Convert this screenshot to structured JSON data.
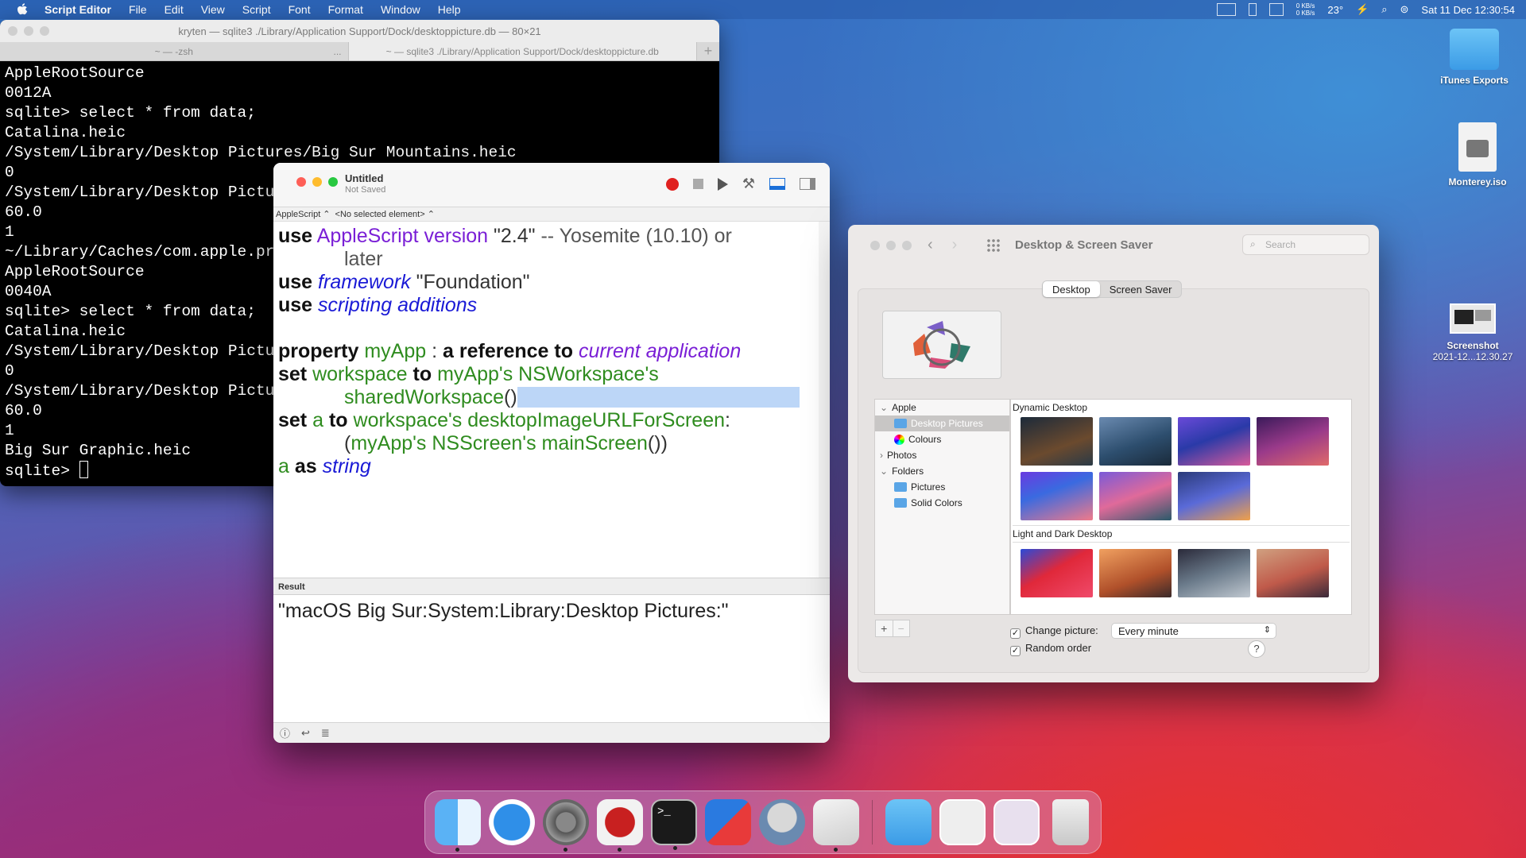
{
  "menubar": {
    "app": "Script Editor",
    "items": [
      "File",
      "Edit",
      "View",
      "Script",
      "Font",
      "Format",
      "Window",
      "Help"
    ],
    "net_up": "0 KB/s",
    "net_down": "0 KB/s",
    "temp": "23°",
    "clock": "Sat 11 Dec  12:30:54"
  },
  "desktop": {
    "icons": [
      {
        "label": "iTunes Exports",
        "sub": ""
      },
      {
        "label": "Monterey.iso",
        "sub": ""
      },
      {
        "label": "Screenshot",
        "sub": "2021-12...12.30.27"
      }
    ]
  },
  "terminal": {
    "title": "kryten — sqlite3 ./Library/Application Support/Dock/desktoppicture.db — 80×21",
    "tab1": "~ — -zsh",
    "tab1_more": "...",
    "tab2": "~ — sqlite3 ./Library/Application Support/Dock/desktoppicture.db",
    "text": "AppleRootSource\n0012A\nsqlite> select * from data;\nCatalina.heic\n/System/Library/Desktop Pictures/Big Sur Mountains.heic\n0\n/System/Library/Desktop Pictures/Big Sur Graphic.heic\n60.0\n1\n~/Library/Caches/com.apple.preferences.dynamicdesktop\nAppleRootSource\n0040A\nsqlite> select * from data;\nCatalina.heic\n/System/Library/Desktop Pictures/Big Sur Mountains.heic\n0\n/System/Library/Desktop Pictures/Big Sur Graphic.heic\n60.0\n1\nBig Sur Graphic.heic\nsqlite> "
  },
  "script_editor": {
    "title": "Untitled",
    "subtitle": "Not Saved",
    "lang": "AppleScript ⌃",
    "element": "<No selected element> ⌃",
    "code": {
      "use": "use",
      "AppleScript": "AppleScript",
      "version": "version",
      "ver_str": " \"2.4\" ",
      "comment1": "-- Yosemite (10.10) or",
      "comment2": "later",
      "framework": "framework",
      "foundation": " \"Foundation\"",
      "scripting": "scripting additions",
      "property": "property",
      "myApp": "myApp",
      "colon": " : ",
      "aref": "a reference to",
      "current": "current application",
      "set": "set",
      "workspace": "workspace",
      "to": "to",
      "ws_expr": "myApp's NSWorkspace's",
      "shared": "sharedWorkspace",
      "paren": "()",
      "a": "a",
      "dimg": "workspace's desktopImageURLForScreen",
      "colon2": ":",
      "open": "(",
      "ms": "myApp's NSScreen's mainScreen",
      "close": "())",
      "as": "as",
      "string": "string"
    },
    "result_label": "Result",
    "result": "\"macOS Big Sur:System:Library:Desktop Pictures:\""
  },
  "prefs": {
    "title": "Desktop & Screen Saver",
    "search": "Search",
    "tab_desktop": "Desktop",
    "tab_saver": "Screen Saver",
    "sources": [
      {
        "label": "Apple",
        "level": 0,
        "arrow": "⌄"
      },
      {
        "label": "Desktop Pictures",
        "level": 1,
        "selected": true
      },
      {
        "label": "Colours",
        "level": 1
      },
      {
        "label": "Photos",
        "level": 0,
        "arrow": "›"
      },
      {
        "label": "Folders",
        "level": 0,
        "arrow": "⌄"
      },
      {
        "label": "Pictures",
        "level": 1
      },
      {
        "label": "Solid Colors",
        "level": 1
      }
    ],
    "section1": "Dynamic Desktop",
    "section2": "Light and Dark Desktop",
    "change_picture": "Change picture:",
    "interval": "Every minute",
    "random": "Random order",
    "plus": "+",
    "minus": "−",
    "help": "?"
  }
}
